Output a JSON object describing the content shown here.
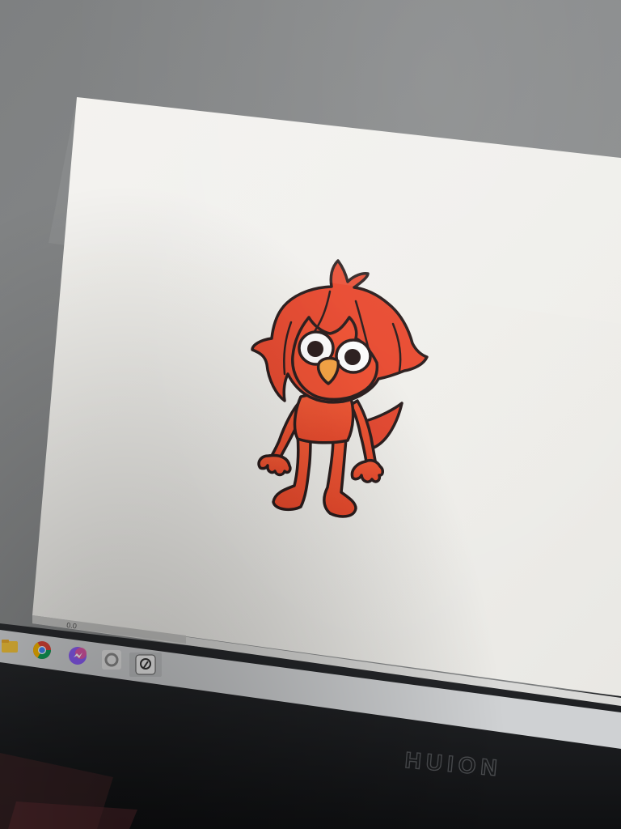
{
  "monitor": {
    "brand": "HUION"
  },
  "editor": {
    "zoom_text": "0.0"
  },
  "taskbar": {
    "apps": [
      {
        "name": "file-explorer-icon"
      },
      {
        "name": "chrome-icon"
      },
      {
        "name": "messenger-icon"
      },
      {
        "name": "app-circle-icon"
      },
      {
        "name": "clip-studio-icon"
      }
    ]
  },
  "colors": {
    "wall": "#7d7f80",
    "screen": "#f1f0ec",
    "bezel": "#1a1b1d",
    "character_fill": "#ef4a2a",
    "character_dark": "#d93a1d",
    "outline": "#231616",
    "nose": "#f7a13d"
  }
}
